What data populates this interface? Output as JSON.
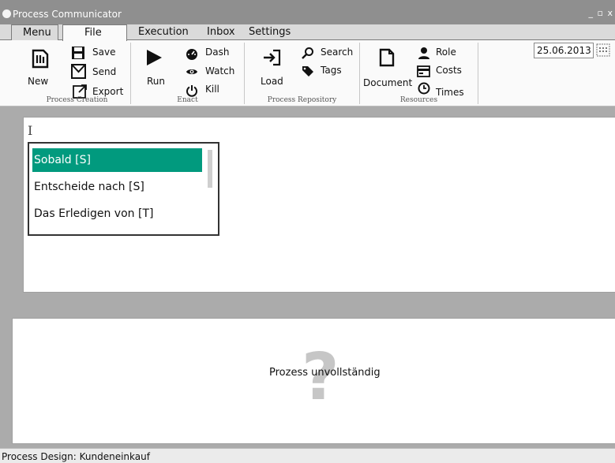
{
  "window": {
    "title": "Process Communicator",
    "controls": "_ ▫ x"
  },
  "menubar": {
    "items": [
      "Menu",
      "File",
      "Execution",
      "Inbox",
      "Settings"
    ],
    "active": "File"
  },
  "ribbon": {
    "groups": {
      "process_creation": {
        "caption": "Process Creation",
        "new": "New",
        "save": "Save",
        "send": "Send",
        "export": "Export"
      },
      "enact": {
        "caption": "Enact",
        "run": "Run",
        "dash": "Dash",
        "watch": "Watch",
        "kill": "Kill"
      },
      "repository": {
        "caption": "Process Repository",
        "load": "Load",
        "search": "Search",
        "tags": "Tags"
      },
      "resources": {
        "caption": "Resources",
        "document": "Document",
        "role": "Role",
        "costs": "Costs",
        "times": "Times"
      }
    },
    "date": "25.06.2013"
  },
  "editor": {
    "caret": "I",
    "suggestions": [
      "Sobald [S]",
      "Entscheide nach [S]",
      "Das Erledigen von [T]"
    ],
    "selected_index": 0
  },
  "lower": {
    "message": "Prozess unvollständig",
    "icon": "question-mark-icon"
  },
  "status": {
    "text": "Process Design: Kundeneinkauf"
  },
  "colors": {
    "accent": "#019a7e",
    "title_bar": "#8f8f8f"
  }
}
